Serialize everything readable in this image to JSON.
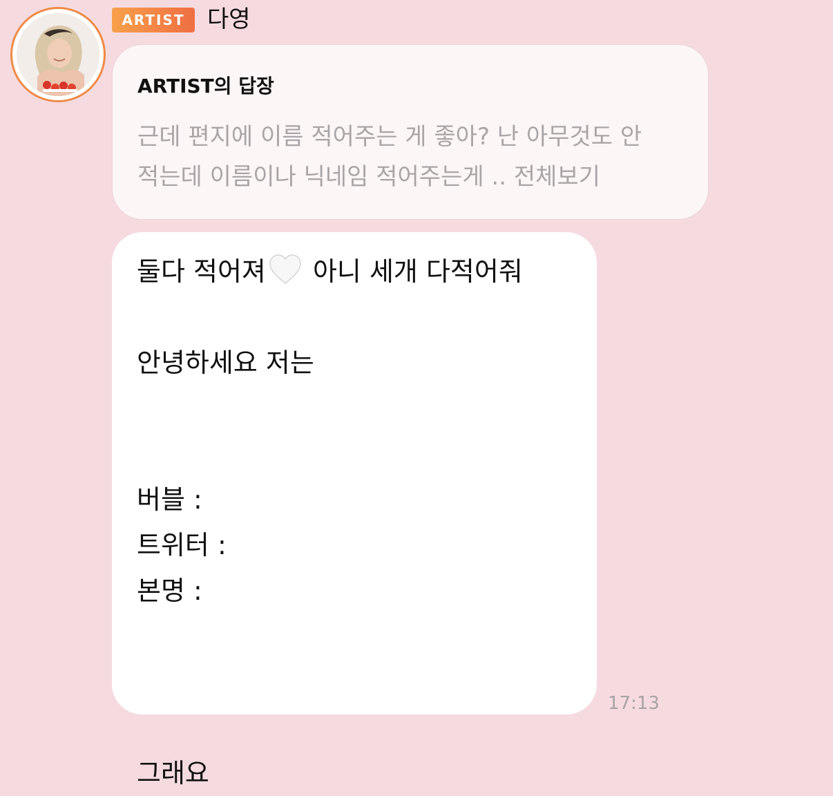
{
  "header": {
    "badge_label": "ARTIST",
    "sender_name": "다영",
    "avatar_icon": "artist-avatar-icon"
  },
  "reply": {
    "title": "ARTIST의 답장",
    "preview_line_1": "근데 편지에 이름 적어주는 게 좋아? 난 아무것도 안",
    "preview_line_2": "적는데 이름이나 닉네임 적어주는게 .. 전체보기"
  },
  "message": {
    "line_1_before": "둘다 적어져",
    "emoji": "white-heart-emoji",
    "line_1_after": " 아니 세개 다적어줘",
    "line_3": "안녕하세요 저는",
    "line_6": "버블 :",
    "line_7": "트위터 :",
    "line_8": "본명 :",
    "line_12": "그래요"
  },
  "timestamp": "17:13",
  "colors": {
    "background": "#f5dbe0",
    "badge_gradient_start": "#f7a04b",
    "badge_gradient_end": "#ef6f42",
    "avatar_ring": "#ef8a45",
    "preview_text": "#a9a5a7",
    "timestamp_text": "#a8a2a5"
  }
}
